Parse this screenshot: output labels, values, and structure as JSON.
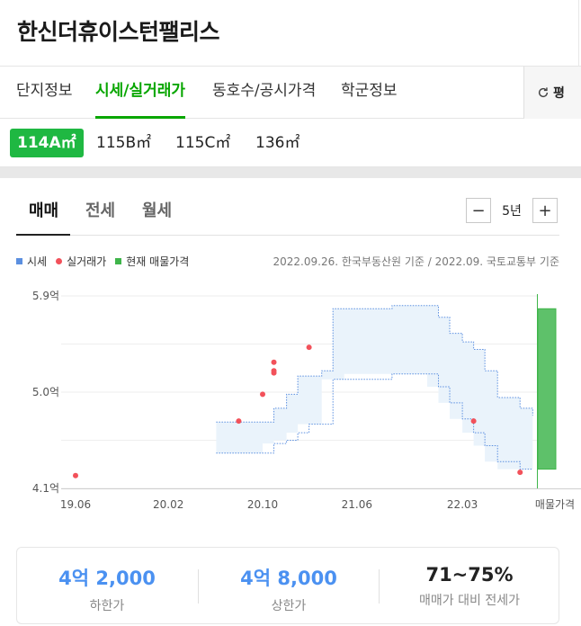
{
  "header": {
    "title": "한신더휴이스턴팰리스"
  },
  "tabs": [
    {
      "label": "단지정보"
    },
    {
      "label": "시세/실거래가"
    },
    {
      "label": "동호수/공시가격"
    },
    {
      "label": "학군정보"
    }
  ],
  "refresh_label": "평",
  "areas": [
    {
      "label": "114A㎡"
    },
    {
      "label": "115B㎡"
    },
    {
      "label": "115C㎡"
    },
    {
      "label": "136㎡"
    }
  ],
  "trade_tabs": [
    {
      "label": "매매"
    },
    {
      "label": "전세"
    },
    {
      "label": "월세"
    }
  ],
  "period": {
    "minus": "−",
    "value": "5년",
    "plus": "+"
  },
  "legend": {
    "market": "시세",
    "actual": "실거래가",
    "listing": "현재 매물가격"
  },
  "source_note": "2022.09.26. 한국부동산원 기준 / 2022.09. 국토교통부 기준",
  "colors": {
    "accent_green": "#08a600",
    "area_active": "#1fb842",
    "market_band": "#5b8fe0",
    "actual_dot": "#f2515a",
    "listing_bar": "#3fb54a",
    "summary_blue": "#4b91f1"
  },
  "chart_data": {
    "type": "area",
    "y_unit": "억",
    "ylim": [
      4.1,
      5.9
    ],
    "yticks": [
      {
        "value": 4.1,
        "label": "4.1억"
      },
      {
        "value": 5.0,
        "label": "5.0억"
      },
      {
        "value": 5.9,
        "label": "5.9억"
      }
    ],
    "xticks": [
      {
        "value": 2019.42,
        "label": "19.06"
      },
      {
        "value": 2020.08,
        "label": "20.02"
      },
      {
        "value": 2020.75,
        "label": "20.10"
      },
      {
        "value": 2021.42,
        "label": "21.06"
      },
      {
        "value": 2022.17,
        "label": "22.03"
      }
    ],
    "xlim": [
      2019.42,
      2022.7
    ],
    "listing_label": "매물가격",
    "listing_range": [
      4.28,
      5.78
    ],
    "market_band": {
      "x": [
        2020.42,
        2020.75,
        2020.83,
        2020.92,
        2021.0,
        2021.08,
        2021.17,
        2021.25,
        2021.33,
        2021.67,
        2021.75,
        2021.83,
        2021.92,
        2022.0,
        2022.08,
        2022.17,
        2022.25,
        2022.33,
        2022.42,
        2022.58,
        2022.67
      ],
      "upper": [
        4.72,
        4.72,
        4.85,
        4.98,
        5.15,
        5.15,
        5.2,
        5.78,
        5.78,
        5.81,
        5.81,
        5.81,
        5.81,
        5.7,
        5.55,
        5.47,
        5.4,
        5.2,
        4.95,
        4.85,
        4.78
      ],
      "lower": [
        4.43,
        4.43,
        4.52,
        4.55,
        4.62,
        4.7,
        4.7,
        5.12,
        5.12,
        5.17,
        5.17,
        5.17,
        5.17,
        5.05,
        4.9,
        4.75,
        4.62,
        4.5,
        4.35,
        4.28,
        4.28
      ]
    },
    "actual_points": [
      {
        "x": 2019.42,
        "y": 4.22
      },
      {
        "x": 2020.58,
        "y": 4.73
      },
      {
        "x": 2020.75,
        "y": 4.98
      },
      {
        "x": 2020.83,
        "y": 5.18
      },
      {
        "x": 2020.83,
        "y": 5.2
      },
      {
        "x": 2020.83,
        "y": 5.28
      },
      {
        "x": 2021.08,
        "y": 5.42
      },
      {
        "x": 2022.25,
        "y": 4.73
      },
      {
        "x": 2022.58,
        "y": 4.25
      }
    ]
  },
  "summary": [
    {
      "value": "4억 2,000",
      "label": "하한가"
    },
    {
      "value": "4억 8,000",
      "label": "상한가"
    },
    {
      "value": "71~75%",
      "label": "매매가 대비 전세가"
    }
  ]
}
